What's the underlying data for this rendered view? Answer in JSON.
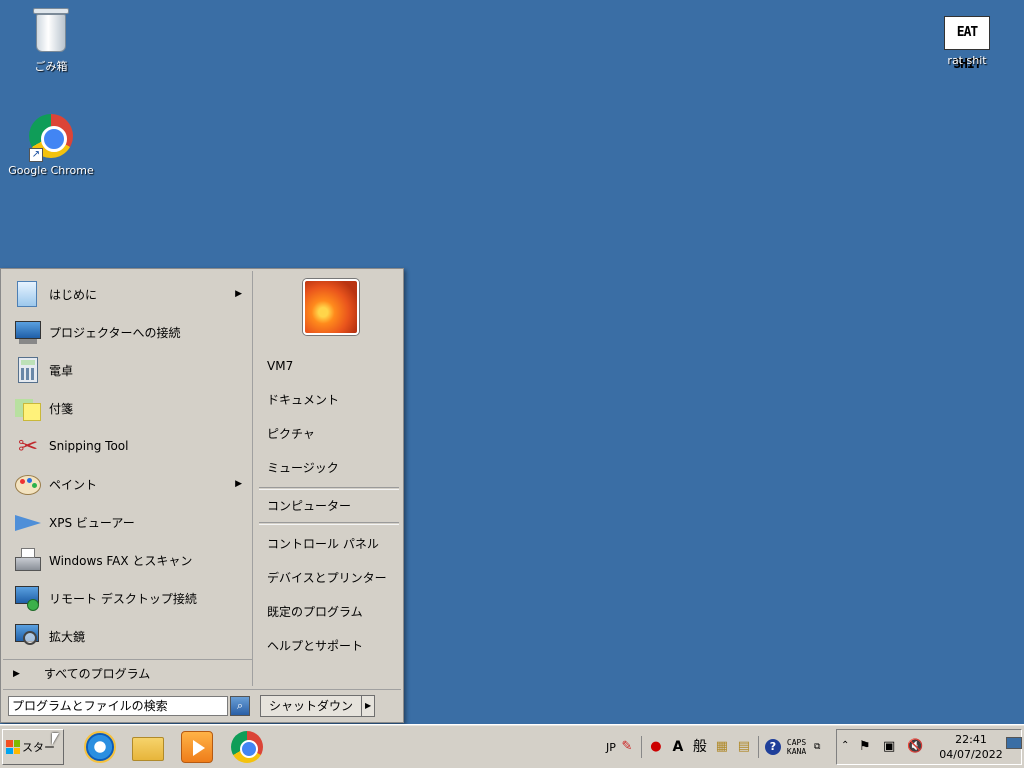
{
  "desktop": {
    "icons": [
      {
        "label": "ごみ箱",
        "icon": "recycle-bin-icon"
      },
      {
        "label": "Google Chrome",
        "icon": "chrome-icon"
      },
      {
        "label": "rat shit",
        "icon": "eat-shit-image-icon",
        "image_text": "EAT SHIT"
      }
    ]
  },
  "start_menu": {
    "programs": [
      {
        "label": "はじめに",
        "icon": "getting-started-icon",
        "has_submenu": true
      },
      {
        "label": "プロジェクターへの接続",
        "icon": "projector-icon",
        "has_submenu": false
      },
      {
        "label": "電卓",
        "icon": "calculator-icon",
        "has_submenu": false
      },
      {
        "label": "付箋",
        "icon": "sticky-notes-icon",
        "has_submenu": false
      },
      {
        "label": "Snipping Tool",
        "icon": "scissors-icon",
        "has_submenu": false
      },
      {
        "label": "ペイント",
        "icon": "paint-palette-icon",
        "has_submenu": true
      },
      {
        "label": "XPS ビューアー",
        "icon": "xps-viewer-icon",
        "has_submenu": false
      },
      {
        "label": "Windows FAX とスキャン",
        "icon": "fax-icon",
        "has_submenu": false
      },
      {
        "label": "リモート デスクトップ接続",
        "icon": "remote-desktop-icon",
        "has_submenu": false
      },
      {
        "label": "拡大鏡",
        "icon": "magnifier-icon",
        "has_submenu": false
      }
    ],
    "all_programs": "すべてのプログラム",
    "right_items": [
      {
        "label": "VM7"
      },
      {
        "label": "ドキュメント"
      },
      {
        "label": "ピクチャ"
      },
      {
        "label": "ミュージック"
      },
      {
        "label": "コンピューター"
      },
      {
        "label": "コントロール パネル"
      },
      {
        "label": "デバイスとプリンター"
      },
      {
        "label": "既定のプログラム"
      },
      {
        "label": "ヘルプとサポート"
      }
    ],
    "search": {
      "value": "プログラムとファイルの検索"
    },
    "shutdown_label": "シャットダウン"
  },
  "taskbar": {
    "start_label": "スタート",
    "visible_start_label": "スター",
    "apps": [
      "internet-explorer-icon",
      "folder-icon",
      "media-player-icon",
      "chrome-icon"
    ],
    "language": "JP",
    "ime_mode": "A",
    "ime_kanji": "般",
    "caps": "CAPS",
    "kana": "KANA",
    "time": "22:41",
    "date": "04/07/2022"
  },
  "colors": {
    "desktop": "#3a6ea5",
    "menu": "#d4d0c8"
  }
}
